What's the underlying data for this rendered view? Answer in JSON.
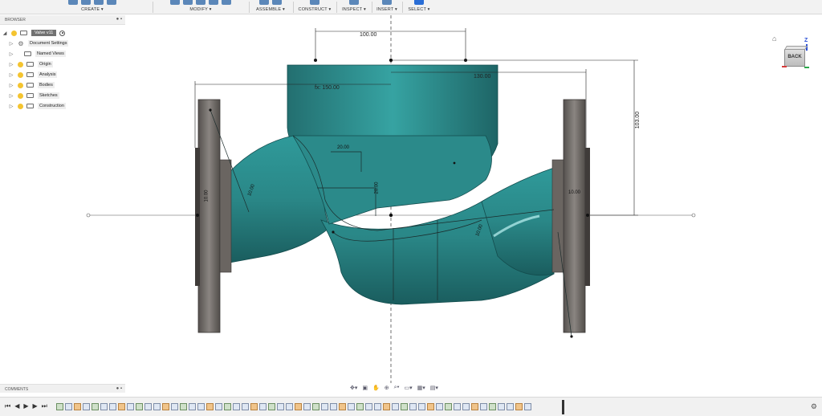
{
  "toolbar": {
    "groups": [
      {
        "label": "CREATE ▾"
      },
      {
        "label": "MODIFY ▾"
      },
      {
        "label": "ASSEMBLE ▾"
      },
      {
        "label": "CONSTRUCT ▾"
      },
      {
        "label": "INSPECT ▾"
      },
      {
        "label": "INSERT ▾"
      },
      {
        "label": "SELECT ▾"
      }
    ]
  },
  "browser": {
    "title": "BROWSER",
    "root": "Valve v11",
    "items": [
      {
        "label": "Document Settings",
        "icon": "gear-icon"
      },
      {
        "label": "Named Views",
        "icon": "folder-icon"
      },
      {
        "label": "Origin",
        "icon": "folder-icon"
      },
      {
        "label": "Analysis",
        "icon": "folder-icon"
      },
      {
        "label": "Bodies",
        "icon": "folder-icon"
      },
      {
        "label": "Sketches",
        "icon": "folder-icon"
      },
      {
        "label": "Construction",
        "icon": "folder-icon"
      }
    ]
  },
  "comments": {
    "title": "COMMENTS"
  },
  "viewcube": {
    "face": "BACK",
    "z_axis": "Z"
  },
  "dimensions": {
    "top_width": "100.00",
    "left_span": "fx: 150.00",
    "right_span": "130.00",
    "height": "103.00",
    "inner_a": "20.00",
    "inner_b": "20.00",
    "right_offset": "10.00",
    "left_offset": "10.00",
    "left_curve": "10.00",
    "right_curve": "10.00"
  },
  "colors": {
    "body": "#2d8c8c",
    "body_dark": "#17595b",
    "flange": "#6e6a66",
    "toolbar": "#f2f2f2",
    "accent": "#2a6ed6"
  }
}
